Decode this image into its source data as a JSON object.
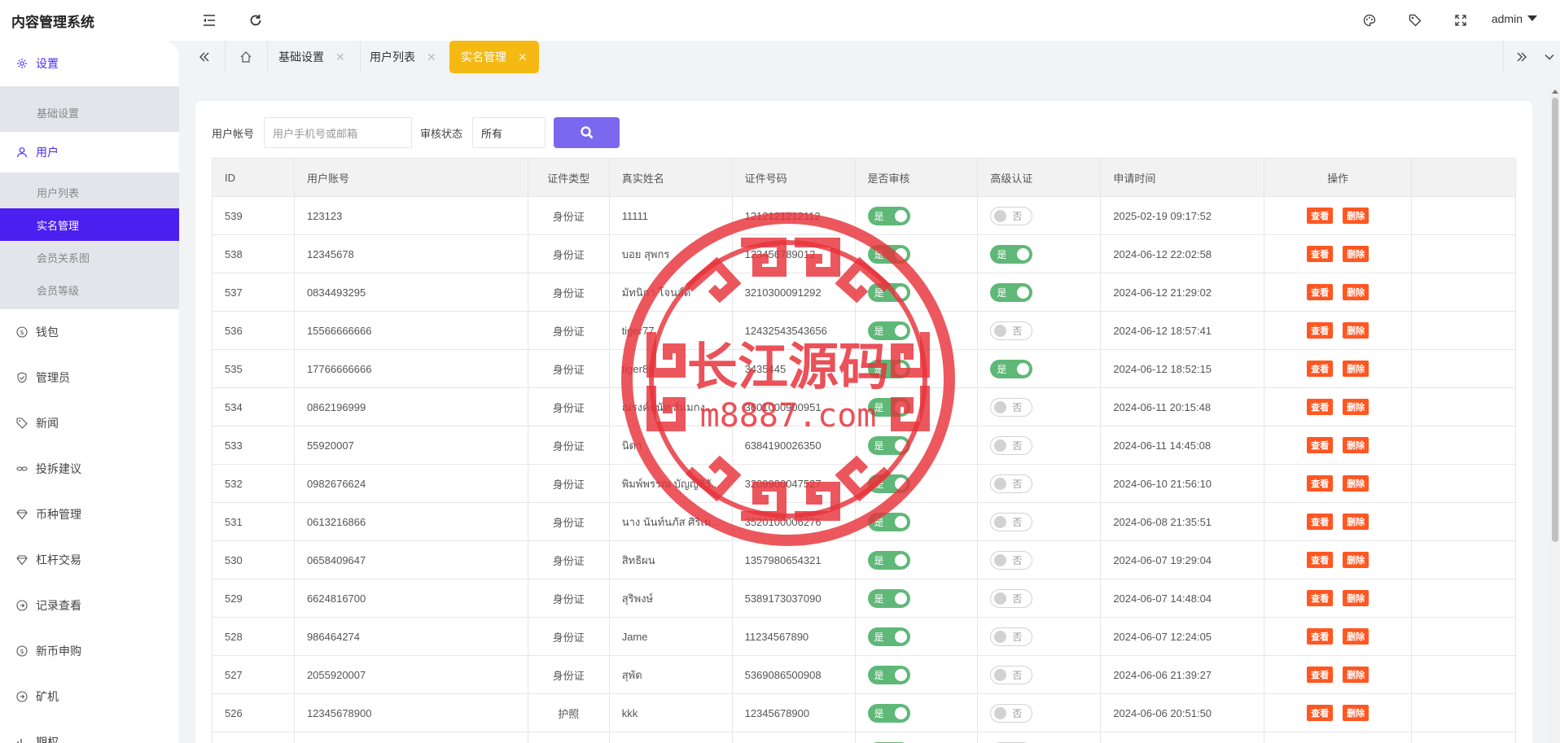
{
  "app": {
    "title": "内容管理系统",
    "user": "admin"
  },
  "sidebar": {
    "settings": {
      "label": "设置",
      "children": [
        "基础设置"
      ]
    },
    "users": {
      "label": "用户",
      "children": [
        "用户列表",
        "实名管理",
        "会员关系图",
        "会员等级"
      ]
    },
    "items": [
      "钱包",
      "管理员",
      "新闻",
      "投拆建议",
      "币种管理",
      "杠杆交易",
      "记录查看",
      "新币申购",
      "矿机",
      "期权"
    ]
  },
  "tabs": [
    {
      "label": "基础设置"
    },
    {
      "label": "用户列表"
    },
    {
      "label": "实名管理"
    }
  ],
  "filter": {
    "account_label": "用户帐号",
    "account_placeholder": "用户手机号或邮箱",
    "status_label": "审核状态",
    "status_value": "所有"
  },
  "table": {
    "headers": [
      "ID",
      "用户账号",
      "证件类型",
      "真实姓名",
      "证件号码",
      "是否审核",
      "高级认证",
      "申请时间",
      "操作"
    ],
    "view_label": "查看",
    "delete_label": "删除",
    "on_label": "是",
    "off_label": "否",
    "rows": [
      {
        "id": "539",
        "account": "123123",
        "type": "身份证",
        "name": "11111",
        "idno": "1212121212112",
        "reviewed": true,
        "advanced": false,
        "time": "2025-02-19 09:17:52"
      },
      {
        "id": "538",
        "account": "12345678",
        "type": "身份证",
        "name": "บอย สุพกร",
        "idno": "123456789012",
        "reviewed": true,
        "advanced": true,
        "time": "2024-06-12 22:02:58"
      },
      {
        "id": "537",
        "account": "0834493295",
        "type": "身份证",
        "name": "มัทนิกา โจนส์ดิ",
        "idno": "3210300091292",
        "reviewed": true,
        "advanced": true,
        "time": "2024-06-12 21:29:02"
      },
      {
        "id": "536",
        "account": "15566666666",
        "type": "身份证",
        "name": "tiger77",
        "idno": "12432543543656",
        "reviewed": true,
        "advanced": false,
        "time": "2024-06-12 18:57:41"
      },
      {
        "id": "535",
        "account": "17766666666",
        "type": "身份证",
        "name": "tiger88",
        "idno": "3435445",
        "reviewed": true,
        "advanced": true,
        "time": "2024-06-12 18:52:15"
      },
      {
        "id": "534",
        "account": "0862196999",
        "type": "身份证",
        "name": "ณรงค์ธนัท ส์แมกง...",
        "idno": "3601000900951",
        "reviewed": true,
        "advanced": false,
        "time": "2024-06-11 20:15:48"
      },
      {
        "id": "533",
        "account": "55920007",
        "type": "身份证",
        "name": "นิดา",
        "idno": "6384190026350",
        "reviewed": true,
        "advanced": false,
        "time": "2024-06-11 14:45:08"
      },
      {
        "id": "532",
        "account": "0982676624",
        "type": "身份证",
        "name": "พิมพ์พรรณ บัญญัติรั...",
        "idno": "3209900047527",
        "reviewed": true,
        "advanced": false,
        "time": "2024-06-10 21:56:10"
      },
      {
        "id": "531",
        "account": "0613216866",
        "type": "身份证",
        "name": "นาง นันท์นภัส ศิริเม...",
        "idno": "3520100006276",
        "reviewed": true,
        "advanced": false,
        "time": "2024-06-08 21:35:51"
      },
      {
        "id": "530",
        "account": "0658409647",
        "type": "身份证",
        "name": "สิทธิผน",
        "idno": "1357980654321",
        "reviewed": true,
        "advanced": false,
        "time": "2024-06-07 19:29:04"
      },
      {
        "id": "529",
        "account": "6624816700",
        "type": "身份证",
        "name": "สุริพงษ์",
        "idno": "5389173037090",
        "reviewed": true,
        "advanced": false,
        "time": "2024-06-07 14:48:04"
      },
      {
        "id": "528",
        "account": "986464274",
        "type": "身份证",
        "name": "Jame",
        "idno": "11234567890",
        "reviewed": true,
        "advanced": false,
        "time": "2024-06-07 12:24:05"
      },
      {
        "id": "527",
        "account": "2055920007",
        "type": "身份证",
        "name": "สุพัด",
        "idno": "5369086500908",
        "reviewed": true,
        "advanced": false,
        "time": "2024-06-06 21:39:27"
      },
      {
        "id": "526",
        "account": "12345678900",
        "type": "护照",
        "name": "kkk",
        "idno": "12345678900",
        "reviewed": true,
        "advanced": false,
        "time": "2024-06-06 20:51:50"
      },
      {
        "id": "",
        "account": "",
        "type": "",
        "name": "",
        "idno": "",
        "reviewed": true,
        "advanced": false,
        "time": ""
      }
    ]
  },
  "watermark": {
    "text": "长江源码",
    "sub": "m8887.com",
    "color": "#e8333b"
  }
}
